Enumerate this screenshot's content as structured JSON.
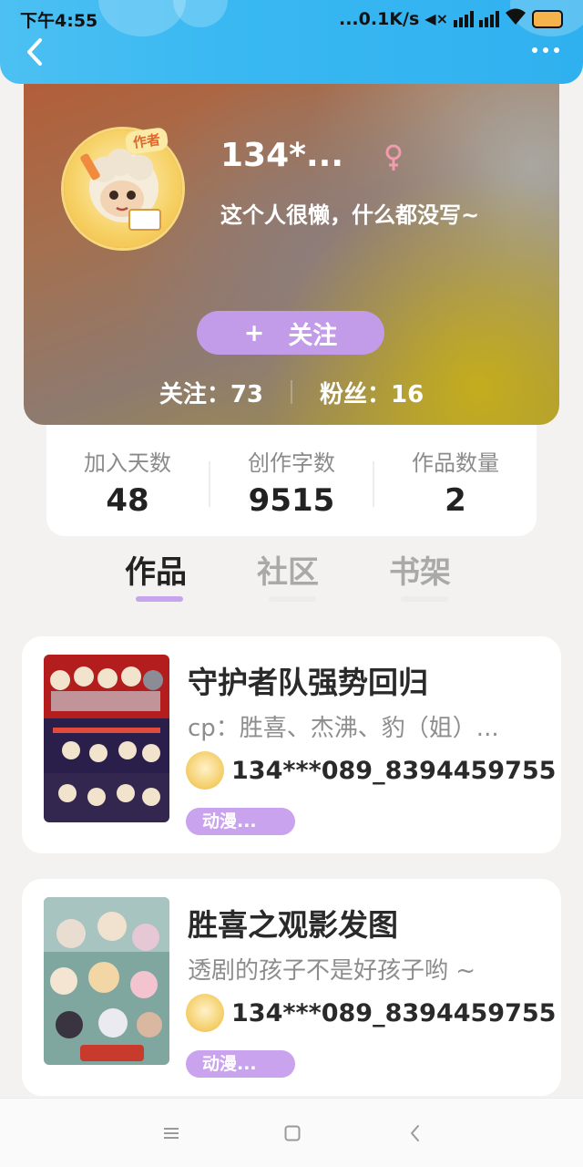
{
  "status_bar": {
    "time": "下午4:55",
    "network_speed": "...0.1K/s"
  },
  "profile": {
    "badge": "作者",
    "username": "134*...",
    "bio": "这个人很懒，什么都没写~",
    "follow_button": {
      "plus": "+",
      "label": "关注"
    },
    "following": "关注：73",
    "followers": "粉丝：16"
  },
  "counts": [
    {
      "label": "加入天数",
      "value": "48"
    },
    {
      "label": "创作字数",
      "value": "9515"
    },
    {
      "label": "作品数量",
      "value": "2"
    }
  ],
  "tabs": [
    {
      "label": "作品",
      "active": true
    },
    {
      "label": "社区",
      "active": false
    },
    {
      "label": "书架",
      "active": false
    }
  ],
  "works": [
    {
      "title": "守护者队强势回归",
      "description": "cp：胜喜、杰沸、豹（姐）...",
      "author": "134***089_8394459755",
      "tag": "动漫..."
    },
    {
      "title": "胜喜之观影发图",
      "description": "透剧的孩子不是好孩子哟 ~",
      "author": "134***089_8394459755",
      "tag": "动漫..."
    }
  ],
  "colors": {
    "accent_purple": "#c29ce8",
    "topbar_blue": "#39b8f2",
    "active_tab_underline": "#c6a4ee"
  }
}
